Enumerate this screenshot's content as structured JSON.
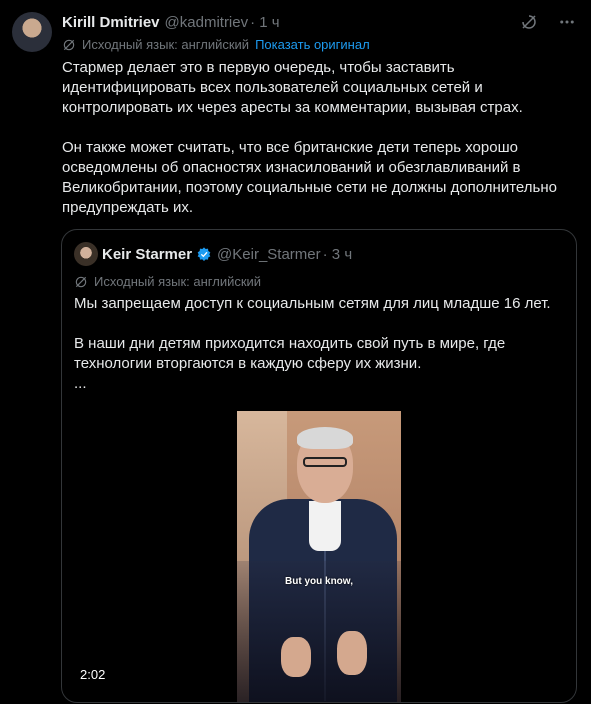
{
  "post": {
    "author_name": "Kirill Dmitriev",
    "author_handle": "@kadmitriev",
    "time": "· 1 ч",
    "translation_note": "Исходный язык: английский",
    "show_original": "Показать оригинал",
    "paragraph1": "Стармер делает это в первую очередь, чтобы заставить идентифицировать всех пользователей социальных сетей и контролировать их через аресты за комментарии, вызывая страх.",
    "paragraph2": "Он также может считать, что все британские дети теперь хорошо осведомлены об опасностях изнасилований и обезглавливаний в Великобритании, поэтому социальные сети не должны дополнительно предупреждать их."
  },
  "quote": {
    "author_name": "Keir Starmer",
    "author_handle": "@Keir_Starmer",
    "time": "· 3 ч",
    "translation_note": "Исходный язык: английский",
    "paragraph1": "Мы запрещаем доступ к социальным сетям для лиц младше 16 лет.",
    "paragraph2": "В наши дни детям приходится находить свой путь в мире, где технологии вторгаются в каждую сферу их жизни.",
    "ellipsis": "...",
    "video": {
      "caption": "But you know,",
      "duration": "2:02"
    }
  },
  "icons": {
    "grok": "grok-icon",
    "more": "more-icon",
    "translate": "translate-icon",
    "verified": "verified-badge-icon"
  },
  "colors": {
    "background": "#000000",
    "text": "#e7e9ea",
    "muted": "#71767b",
    "link": "#1d9bf0",
    "verified": "#1d9bf0",
    "border": "#333639"
  }
}
